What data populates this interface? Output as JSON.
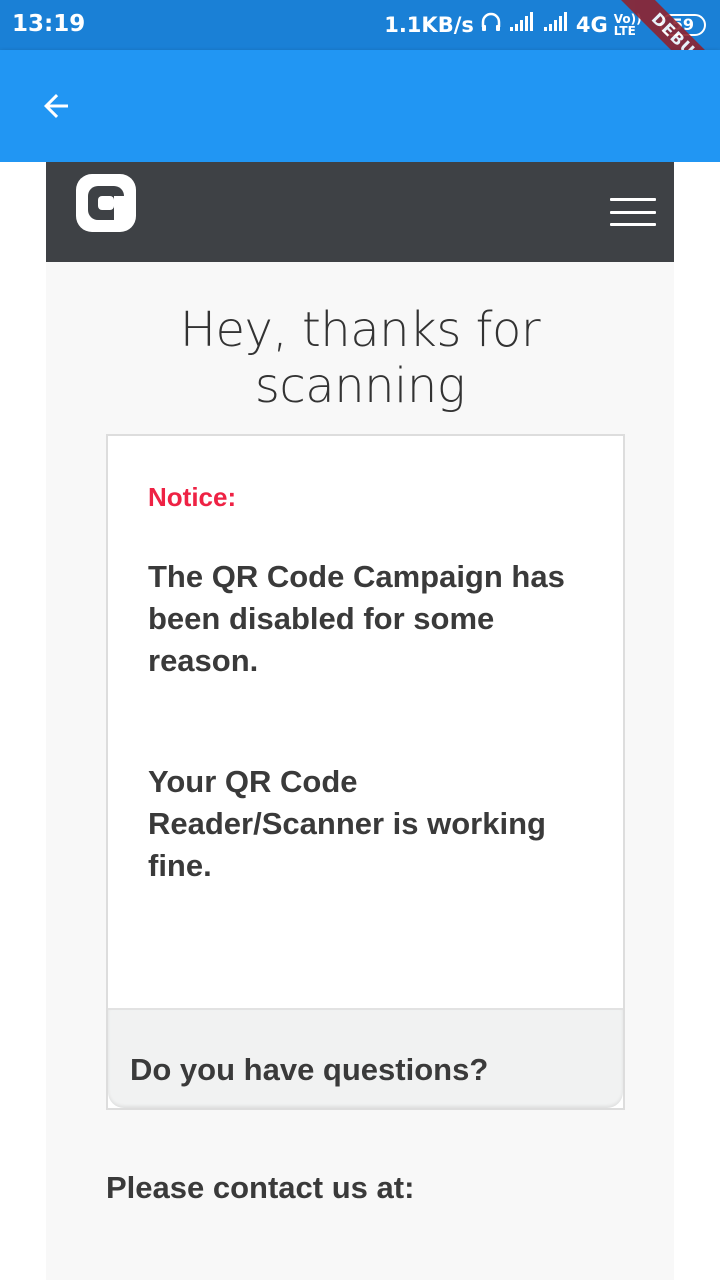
{
  "status_bar": {
    "time": "13:19",
    "speed": "1.1KB/s",
    "network": "4G",
    "volte": "Vo)) LTE",
    "battery": "59"
  },
  "debug_banner": "DEBUG",
  "app_bar": {
    "back_icon": "arrow-back-icon"
  },
  "site": {
    "logo_icon": "brand-logo-icon",
    "menu_icon": "hamburger-menu-icon",
    "hero_title_line1": "Hey, thanks for",
    "hero_title_line2": "scanning",
    "card": {
      "notice_label": "Notice:",
      "paragraph1": "The QR Code Campaign has been disabled for some reason.",
      "paragraph2": "Your QR Code Reader/Scanner is working fine.",
      "footer": "Do you have questions?"
    },
    "contact": "Please contact us at:"
  },
  "colors": {
    "status_bar": "#1a80d6",
    "app_bar": "#2196f3",
    "site_header": "#3e4145",
    "notice": "#ee2244",
    "body_text": "#3a3a3a"
  }
}
